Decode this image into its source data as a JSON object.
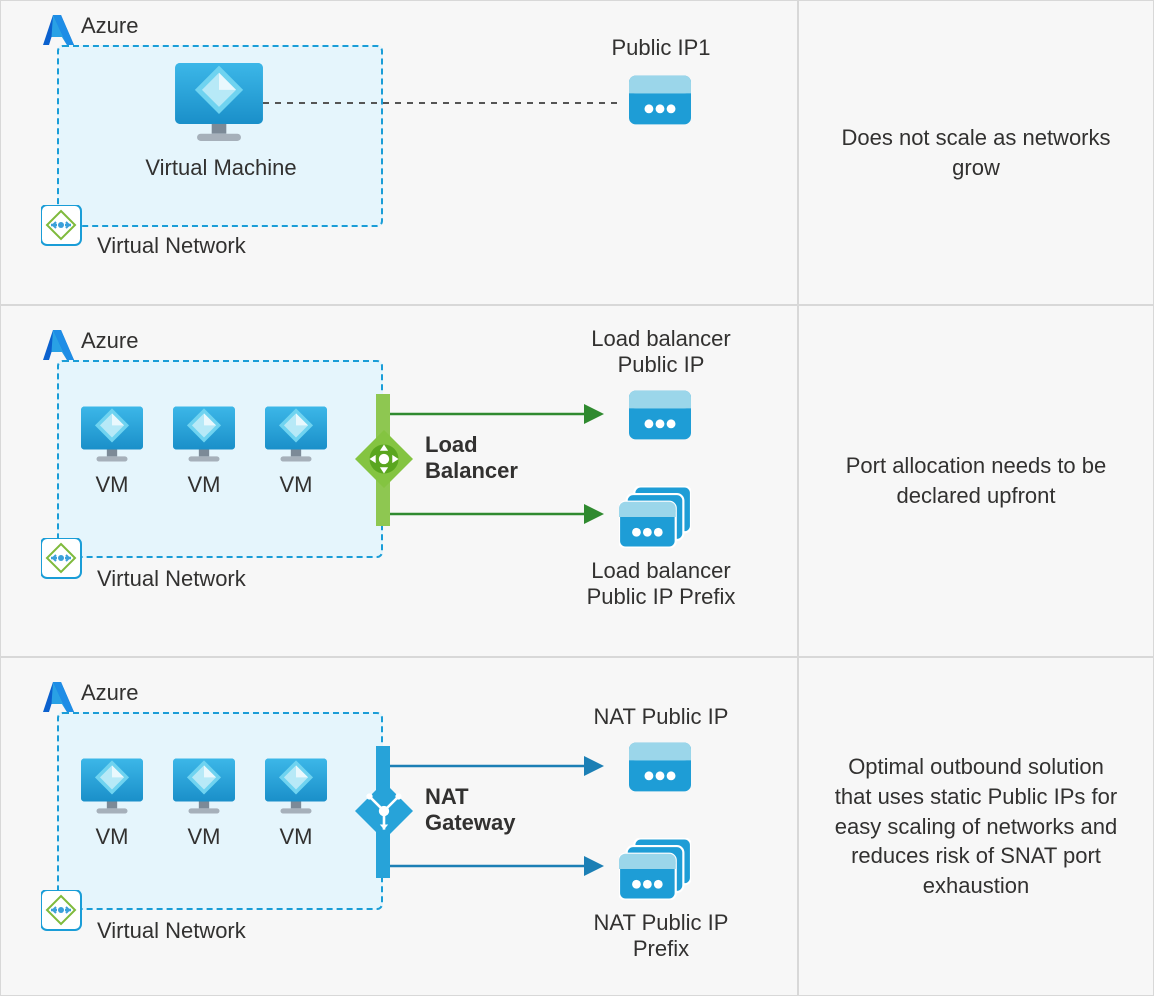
{
  "rows": [
    {
      "azure": "Azure",
      "vnet": "Virtual Network",
      "vm_single": "Virtual Machine",
      "pip1": "Public IP1",
      "desc": "Does not scale as networks grow"
    },
    {
      "azure": "Azure",
      "vnet": "Virtual Network",
      "vms": [
        "VM",
        "VM",
        "VM"
      ],
      "gw_line1": "Load",
      "gw_line2": "Balancer",
      "pip_top_line1": "Load balancer",
      "pip_top_line2": "Public IP",
      "pip_bot_line1": "Load balancer",
      "pip_bot_line2": "Public IP Prefix",
      "desc": "Port allocation needs to be declared upfront"
    },
    {
      "azure": "Azure",
      "vnet": "Virtual Network",
      "vms": [
        "VM",
        "VM",
        "VM"
      ],
      "gw_line1": "NAT",
      "gw_line2": "Gateway",
      "pip_top": "NAT Public IP",
      "pip_bot_line1": "NAT Public IP",
      "pip_bot_line2": "Prefix",
      "desc": "Optimal outbound solution that uses static Public IPs for easy scaling of networks and reduces risk of SNAT port exhaustion"
    }
  ]
}
